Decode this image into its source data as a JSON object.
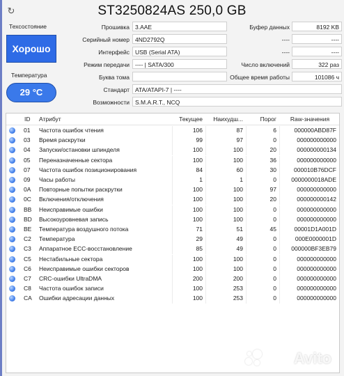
{
  "title": "ST3250824AS 250,0 GB",
  "health": {
    "label": "Техсостояние",
    "status": "Хорошо",
    "status_color": "#2e6be6"
  },
  "temperature": {
    "label": "Температура",
    "value": "29 °C"
  },
  "info_left": [
    {
      "label": "Прошивка",
      "value": "3.AAE"
    },
    {
      "label": "Серийный номер",
      "value": "4ND2792Q"
    },
    {
      "label": "Интерфейс",
      "value": "USB (Serial ATA)"
    },
    {
      "label": "Режим передачи",
      "value": "---- | SATA/300"
    },
    {
      "label": "Буква тома",
      "value": ""
    }
  ],
  "info_right": [
    {
      "label": "Буфер данных",
      "value": "8192 KB"
    },
    {
      "label": "",
      "value": "----"
    },
    {
      "label": "",
      "value": "----"
    },
    {
      "label": "Число включений",
      "value": "322 раз"
    },
    {
      "label": "Общее время работы",
      "value": "101086 ч"
    }
  ],
  "standard": {
    "label": "Стандарт",
    "value": "ATA/ATAPI-7 | ----"
  },
  "features": {
    "label": "Возможности",
    "value": "S.M.A.R.T., NCQ"
  },
  "table": {
    "headers": {
      "id": "ID",
      "attr": "Атрибут",
      "current": "Текущее",
      "worst": "Наихудш...",
      "threshold": "Порог",
      "raw": "Raw-значения"
    },
    "rows": [
      {
        "id": "01",
        "attr": "Частота ошибок чтения",
        "current": "106",
        "worst": "87",
        "threshold": "6",
        "raw": "000000ABD87F"
      },
      {
        "id": "03",
        "attr": "Время раскрутки",
        "current": "99",
        "worst": "97",
        "threshold": "0",
        "raw": "000000000000"
      },
      {
        "id": "04",
        "attr": "Запуски/остановки шпинделя",
        "current": "100",
        "worst": "100",
        "threshold": "20",
        "raw": "000000000134"
      },
      {
        "id": "05",
        "attr": "Переназначенные сектора",
        "current": "100",
        "worst": "100",
        "threshold": "36",
        "raw": "000000000000"
      },
      {
        "id": "07",
        "attr": "Частота ошибок позиционирования",
        "current": "84",
        "worst": "60",
        "threshold": "30",
        "raw": "000010B76DCF"
      },
      {
        "id": "09",
        "attr": "Часы работы",
        "current": "1",
        "worst": "1",
        "threshold": "0",
        "raw": "0000000018ADE"
      },
      {
        "id": "0A",
        "attr": "Повторные попытки раскрутки",
        "current": "100",
        "worst": "100",
        "threshold": "97",
        "raw": "000000000000"
      },
      {
        "id": "0C",
        "attr": "Включения/отключения",
        "current": "100",
        "worst": "100",
        "threshold": "20",
        "raw": "000000000142"
      },
      {
        "id": "BB",
        "attr": "Неисправимые ошибки",
        "current": "100",
        "worst": "100",
        "threshold": "0",
        "raw": "000000000000"
      },
      {
        "id": "BD",
        "attr": "Высокоуровневая запись",
        "current": "100",
        "worst": "100",
        "threshold": "0",
        "raw": "000000000000"
      },
      {
        "id": "BE",
        "attr": "Температура воздушного потока",
        "current": "71",
        "worst": "51",
        "threshold": "45",
        "raw": "00001D1A001D"
      },
      {
        "id": "C2",
        "attr": "Температура",
        "current": "29",
        "worst": "49",
        "threshold": "0",
        "raw": "000E0000001D"
      },
      {
        "id": "C3",
        "attr": "Аппаратное ECC-восстановление",
        "current": "85",
        "worst": "49",
        "threshold": "0",
        "raw": "000000BF3EB79"
      },
      {
        "id": "C5",
        "attr": "Нестабильные сектора",
        "current": "100",
        "worst": "100",
        "threshold": "0",
        "raw": "000000000000"
      },
      {
        "id": "C6",
        "attr": "Неисправимые ошибки секторов",
        "current": "100",
        "worst": "100",
        "threshold": "0",
        "raw": "000000000000"
      },
      {
        "id": "C7",
        "attr": "CRC-ошибки UltraDMA",
        "current": "200",
        "worst": "200",
        "threshold": "0",
        "raw": "000000000000"
      },
      {
        "id": "C8",
        "attr": "Частота ошибок записи",
        "current": "100",
        "worst": "253",
        "threshold": "0",
        "raw": "000000000000"
      },
      {
        "id": "CA",
        "attr": "Ошибки адресации данных",
        "current": "100",
        "worst": "253",
        "threshold": "0",
        "raw": "000000000000"
      }
    ]
  },
  "watermark": "Avito"
}
